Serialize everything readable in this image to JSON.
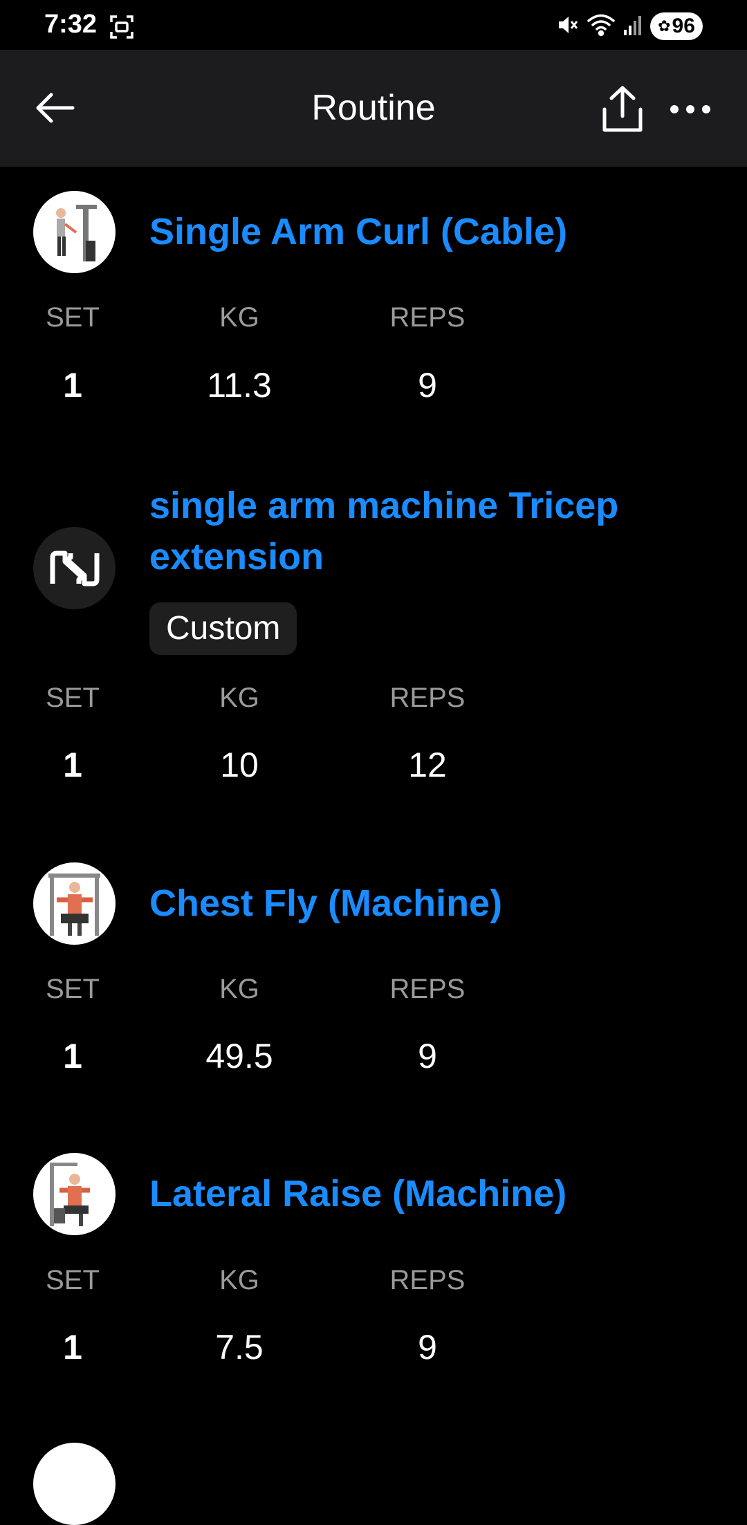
{
  "status_bar": {
    "time": "7:32",
    "battery": "96",
    "icons": [
      "screenshot-icon",
      "mute-icon",
      "wifi-icon",
      "signal-icon",
      "battery-icon"
    ]
  },
  "app_bar": {
    "title": "Routine",
    "icons": [
      "back-arrow-icon",
      "share-icon",
      "more-icon"
    ]
  },
  "columns": {
    "set": "SET",
    "kg": "KG",
    "reps": "REPS"
  },
  "exercises": [
    {
      "name": "Single Arm Curl (Cable)",
      "tag": "",
      "set": "1",
      "kg": "11.3",
      "reps": "9"
    },
    {
      "name_line1": "single arm machine Tricep",
      "name_line2": "extension",
      "tag": "Custom",
      "set": "1",
      "kg": "10",
      "reps": "12"
    },
    {
      "name": "Chest Fly (Machine)",
      "tag": "",
      "set": "1",
      "kg": "49.5",
      "reps": "9"
    },
    {
      "name": "Lateral Raise (Machine)",
      "tag": "",
      "set": "1",
      "kg": "7.5",
      "reps": "9"
    }
  ],
  "colors": {
    "accent": "#1a8cff",
    "appbar": "#1c1c1e",
    "muted": "#9a9a9a"
  }
}
